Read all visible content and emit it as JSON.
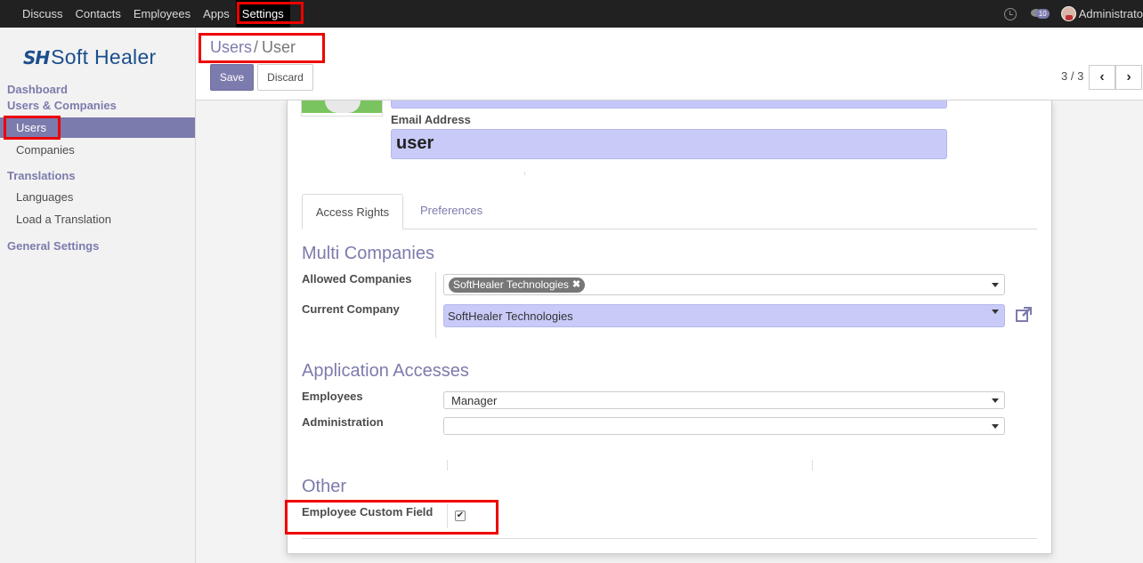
{
  "topbar": {
    "menu": [
      "Discuss",
      "Contacts",
      "Employees",
      "Apps",
      "Settings"
    ],
    "active": "Settings",
    "chat_badge": "10",
    "username": "Administrato"
  },
  "sidebar": {
    "logo_mark": "SH",
    "logo_text": "Soft Healer",
    "sections": {
      "dashboard": "Dashboard",
      "users_companies": "Users & Companies",
      "users": "Users",
      "companies": "Companies",
      "translations": "Translations",
      "languages": "Languages",
      "load_translation": "Load a Translation",
      "general_settings": "General Settings"
    }
  },
  "control_panel": {
    "breadcrumb_parent": "Users",
    "breadcrumb_sep": "/",
    "breadcrumb_current": "User",
    "save_label": "Save",
    "discard_label": "Discard",
    "pager": "3 / 3"
  },
  "form": {
    "email_label": "Email Address",
    "email_value": "user",
    "tabs": [
      "Access Rights",
      "Preferences"
    ],
    "multi_companies": {
      "title": "Multi Companies",
      "allowed_label": "Allowed Companies",
      "allowed_tag": "SoftHealer Technologies",
      "current_label": "Current Company",
      "current_value": "SoftHealer Technologies"
    },
    "app_accesses": {
      "title": "Application Accesses",
      "employees_label": "Employees",
      "employees_value": "Manager",
      "administration_label": "Administration",
      "administration_value": ""
    },
    "other": {
      "title": "Other",
      "custom_field_label": "Employee Custom Field",
      "custom_field_checked": true
    }
  },
  "colors": {
    "accent": "#7c7bad",
    "highlight": "#ee0000",
    "topbar": "#212121"
  }
}
